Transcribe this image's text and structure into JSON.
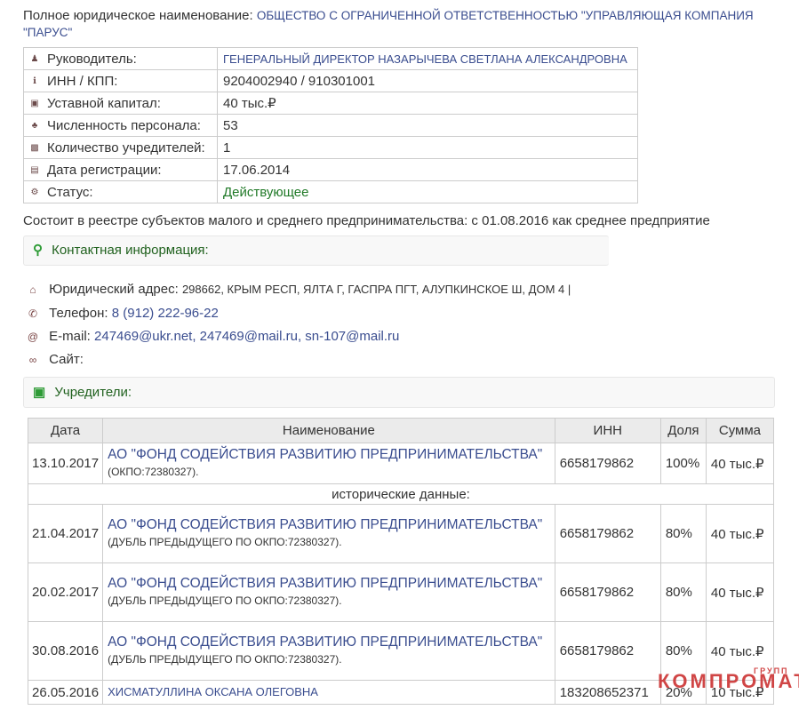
{
  "company": {
    "full_name_label": "Полное юридическое наименование:",
    "full_name": "ОБЩЕСТВО С ОГРАНИЧЕННОЙ ОТВЕТСТВЕННОСТЬЮ \"УПРАВЛЯЮЩАЯ КОМПАНИЯ \"ПАРУС\""
  },
  "info": [
    {
      "icon": "person-icon",
      "glyph": "♟",
      "label": "Руководитель:",
      "value": "ГЕНЕРАЛЬНЫЙ ДИРЕКТОР НАЗАРЫЧЕВА СВЕТЛАНА АЛЕКСАНДРОВНА",
      "style": "caps"
    },
    {
      "icon": "info-icon",
      "glyph": "ℹ",
      "label": "ИНН / КПП:",
      "value": "9204002940 / 910301001",
      "style": ""
    },
    {
      "icon": "money-icon",
      "glyph": "▣",
      "label": "Уставной капитал:",
      "value": "40 тыс.₽",
      "style": ""
    },
    {
      "icon": "group-icon",
      "glyph": "♣",
      "label": "Численность персонала:",
      "value": "53",
      "style": ""
    },
    {
      "icon": "founder-icon",
      "glyph": "▩",
      "label": "Количество учредителей:",
      "value": "1",
      "style": ""
    },
    {
      "icon": "calendar-icon",
      "glyph": "▤",
      "label": "Дата регистрации:",
      "value": "17.06.2014",
      "style": ""
    },
    {
      "icon": "cogs-icon",
      "glyph": "⚙",
      "label": "Статус:",
      "value": "Действующее",
      "style": "green"
    }
  ],
  "smb_note": "Состоит в реестре субъектов малого и среднего предпринимательства: с 01.08.2016 как среднее предприятие",
  "contact": {
    "header": "Контактная информация:",
    "address_label": "Юридический адрес:",
    "address": "298662, КРЫМ РЕСП, ЯЛТА Г, ГАСПРА ПГТ, АЛУПКИНСКОЕ Ш, ДОМ 4 |",
    "phone_label": "Телефон:",
    "phone": "8 (912) 222-96-22",
    "email_label": "E-mail:",
    "emails": "247469@ukr.net, 247469@mail.ru, sn-107@mail.ru",
    "site_label": "Сайт:"
  },
  "founders": {
    "header": "Учредители:",
    "columns": [
      "Дата",
      "Наименование",
      "ИНН",
      "Доля",
      "Сумма"
    ],
    "current": {
      "date": "13.10.2017",
      "name": "АО \"ФОНД СОДЕЙСТВИЯ РАЗВИТИЮ ПРЕДПРИНИМАТЕЛЬСТВА\"",
      "note": "(ОКПО:72380327).",
      "inn": "6658179862",
      "share": "100%",
      "sum": "40 тыс.₽"
    },
    "history_label": "исторические данные:",
    "history": [
      {
        "date": "21.04.2017",
        "name": "АО \"ФОНД СОДЕЙСТВИЯ РАЗВИТИЮ ПРЕДПРИНИМАТЕЛЬСТВА\"",
        "note": "(ДУБЛЬ ПРЕДЫДУЩЕГО ПО ОКПО:72380327).",
        "inn": "6658179862",
        "share": "80%",
        "sum": "40 тыс.₽"
      },
      {
        "date": "20.02.2017",
        "name": "АО \"ФОНД СОДЕЙСТВИЯ РАЗВИТИЮ ПРЕДПРИНИМАТЕЛЬСТВА\"",
        "note": "(ДУБЛЬ ПРЕДЫДУЩЕГО ПО ОКПО:72380327).",
        "inn": "6658179862",
        "share": "80%",
        "sum": "40 тыс.₽"
      },
      {
        "date": "30.08.2016",
        "name": "АО \"ФОНД СОДЕЙСТВИЯ РАЗВИТИЮ ПРЕДПРИНИМАТЕЛЬСТВА\"",
        "note": "(ДУБЛЬ ПРЕДЫДУЩЕГО ПО ОКПО:72380327).",
        "inn": "6658179862",
        "share": "80%",
        "sum": "40 тыс.₽"
      },
      {
        "date": "26.05.2016",
        "name": "ХИСМАТУЛЛИНА ОКСАНА ОЛЕГОВНА",
        "note": "",
        "inn": "183208652371",
        "share": "20%",
        "sum": "10 тыс.₽"
      }
    ]
  },
  "watermark": {
    "main": "КОМПРОМАТ",
    "small": "ГРУПП"
  }
}
